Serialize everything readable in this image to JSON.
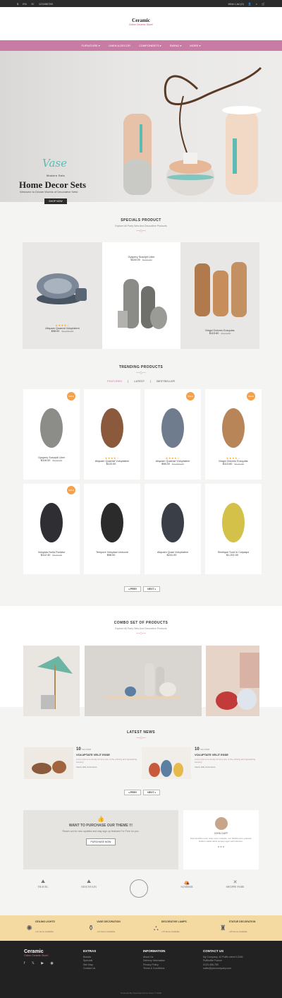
{
  "topbar": {
    "currency": "$",
    "lang": "EN",
    "phone": "123456789",
    "wishlist": "Wish List (0)"
  },
  "logo": {
    "title": "Ceramic",
    "tagline": "Online Ceramic Store!"
  },
  "nav": [
    "FURNITURE",
    "LINEN & DECOR",
    "COMPONENTS",
    "SWING",
    "MORE"
  ],
  "hero": {
    "script": "Vase",
    "kicker": "Modern Sets",
    "heading": "Home Decor Sets",
    "welcome": "Welcome to Dream Worlds of Decorative Sets!",
    "button": "SHOP NOW"
  },
  "specials": {
    "title": "SPECIALS PRODUCT",
    "subtitle": "Explore All Party Sets And Decorative Products",
    "items": [
      {
        "name": "Aliquam Quaerat Voluptatem",
        "price": "$98.00",
        "old": "$1,000.00"
      },
      {
        "name": "Gyspery Suscipit Liber",
        "price": "$116.00",
        "old": "$122.00"
      },
      {
        "name": "Magni Dolores Eosqulas",
        "price": "$113.60",
        "old": "$122.00"
      }
    ]
  },
  "trending": {
    "title": "TRENDING PRODUCTS",
    "tabs": [
      "FEATURED",
      "LATEST",
      "BESTSELLER"
    ],
    "sale": "SALE",
    "items": [
      {
        "name": "Gyspery Suscipit Liber",
        "price": "$116.00",
        "old": "$122.00"
      },
      {
        "name": "Aliquam Quaerat Voluptatem",
        "price": "$122.00",
        "old": ""
      },
      {
        "name": "Aliquam Quaerat Voluptatem",
        "price": "$98.00",
        "old": "$1,000.00"
      },
      {
        "name": "Magni Dolores Eosqulas",
        "price": "$113.60",
        "old": "$122.00"
      },
      {
        "name": "Voluptas Nulla Pariatur",
        "price": "$112.40",
        "old": "$122.00"
      },
      {
        "name": "Tempore Voluptas Undoore",
        "price": "$98.00",
        "old": ""
      },
      {
        "name": "Aliquam Quae Voluptatem",
        "price": "$241.00",
        "old": ""
      },
      {
        "name": "Similique Sunt In Culpaqui",
        "price": "$1,202.00",
        "old": ""
      }
    ],
    "prev": "PREV",
    "next": "NEXT"
  },
  "combo": {
    "title": "COMBO SET OF PRODUCTS",
    "subtitle": "Explore All Party Sets And Decorative Products"
  },
  "news": {
    "title": "LATEST NEWS",
    "items": [
      {
        "day": "10",
        "month": "JAN 2018",
        "title": "VOLUPTATE VELIT ESSE",
        "text": "Lorem ipsum is simply dummy text of the printing and typesetting industry.",
        "meta": "Views (24)  Comments"
      },
      {
        "day": "10",
        "month": "JAN 2018",
        "title": "VOLUPTATE VELIT ESSE",
        "text": "Lorem ipsum is simply dummy text of the printing and typesetting industry.",
        "meta": "Views (24)  Comments"
      }
    ],
    "prev": "PREV",
    "next": "NEXT"
  },
  "cta": {
    "title": "WANT TO PURCHASE OUR THEME !!!",
    "text": "Reach out for new updates and stay sign up features For Free for you.",
    "button": "PURCHASE NOW"
  },
  "testimonial": {
    "name": "JOHN DUFF",
    "text": "Duis faucibus enim vitae nunc molestie, nec facilisis arcu pulvinar. Nullam mattis tellus semper eget velit interdum."
  },
  "brands": [
    "TRAVEL",
    "MOUNTAIN",
    "",
    "SUMMER",
    "SHOPPE-FARE"
  ],
  "features": [
    {
      "title": "CEILING LIGHTS",
      "sub": "+12 Items Available"
    },
    {
      "title": "VASE DECORATION",
      "sub": "+12 Items Available"
    },
    {
      "title": "DECORATIVE LAMPS",
      "sub": "+75 Items Available"
    },
    {
      "title": "STATUE DECORATION",
      "sub": "+25 Items Available"
    }
  ],
  "footer": {
    "logo": "Ceramic",
    "tagline": "Online Ceramic Store!",
    "extras": {
      "title": "EXTRAS",
      "links": [
        "Brands",
        "Specials",
        "Site Map",
        "Contact Us"
      ]
    },
    "info": {
      "title": "INFORMATION",
      "links": [
        "About Us",
        "Delivery Information",
        "Privacy Policy",
        "Terms & Conditions"
      ]
    },
    "contact": {
      "title": "CONTACT US",
      "lines": [
        "My Company, 42 Puffin street 12345",
        "Puffinville France",
        "0123-456-789",
        "sales@yourcompany.com"
      ]
    },
    "copyright": "Powered By OpenCart Demo Store © 2018"
  }
}
